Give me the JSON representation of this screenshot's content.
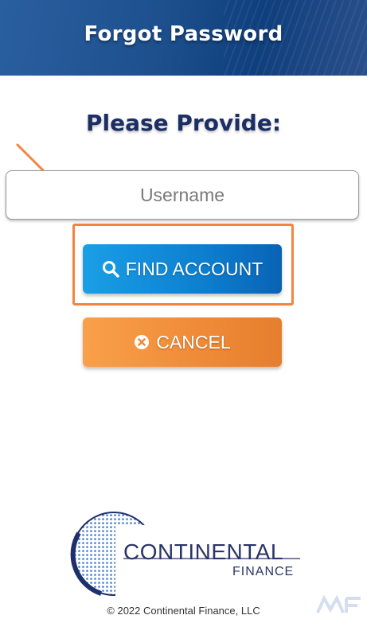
{
  "header": {
    "title": "Forgot Password"
  },
  "form": {
    "heading": "Please Provide:",
    "username_placeholder": "Username",
    "username_value": ""
  },
  "buttons": {
    "find_account": {
      "label": "FIND ACCOUNT",
      "icon": "search-icon"
    },
    "cancel": {
      "label": "CANCEL",
      "icon": "times-circle-icon"
    }
  },
  "logo": {
    "name": "CONTINENTAL",
    "subname": "FINANCE"
  },
  "footer": {
    "copyright": "© 2022 Continental Finance, LLC"
  },
  "colors": {
    "header_blue": "#1d4f8d",
    "heading_navy": "#1c2f63",
    "find_blue": "#0d7fd0",
    "cancel_orange": "#f08c39",
    "annotation_orange": "#f5833f"
  }
}
